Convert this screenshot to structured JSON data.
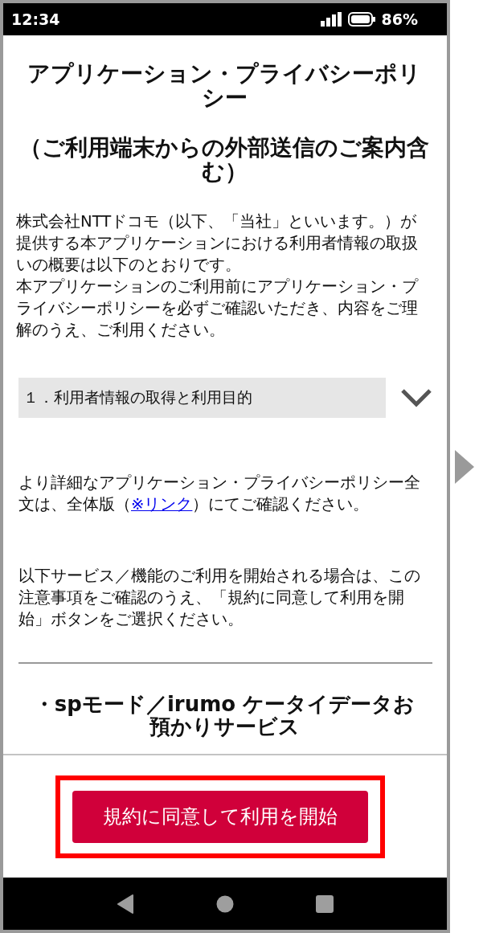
{
  "status_bar": {
    "time": "12:34",
    "battery": "86%"
  },
  "title": "アプリケーション・プライバシーポリシー",
  "subtitle": "（ご利用端末からの外部送信のご案内含む）",
  "intro": [
    "株式会社NTTドコモ（以下、「当社」といいます。）が提供する本アプリケーションにおける利用者情報の取扱いの概要は以下のとおりです。",
    "本アプリケーションのご利用前にアプリケーション・プライバシーポリシーを必ずご確認いただき、内容をご理解のうえ、ご利用ください。"
  ],
  "sections": [
    {
      "label": "１．利用者情報の取得と利用目的",
      "expanded": false
    }
  ],
  "detail": {
    "before": "より詳細なアプリケーション・プライバシーポリシー全文は、全体版（",
    "link": "※リンク",
    "after": "）にてご確認ください。"
  },
  "notice": "以下サービス／機能のご利用を開始される場合は、この注意事項をご確認のうえ、「規約に同意して利用を開始」ボタンをご選択ください。",
  "services": [
    "・spモード／irumo ケータイデータお預かりサービス"
  ],
  "agree_button": {
    "label": "規約に同意して利用を開始",
    "highlighted": true
  }
}
